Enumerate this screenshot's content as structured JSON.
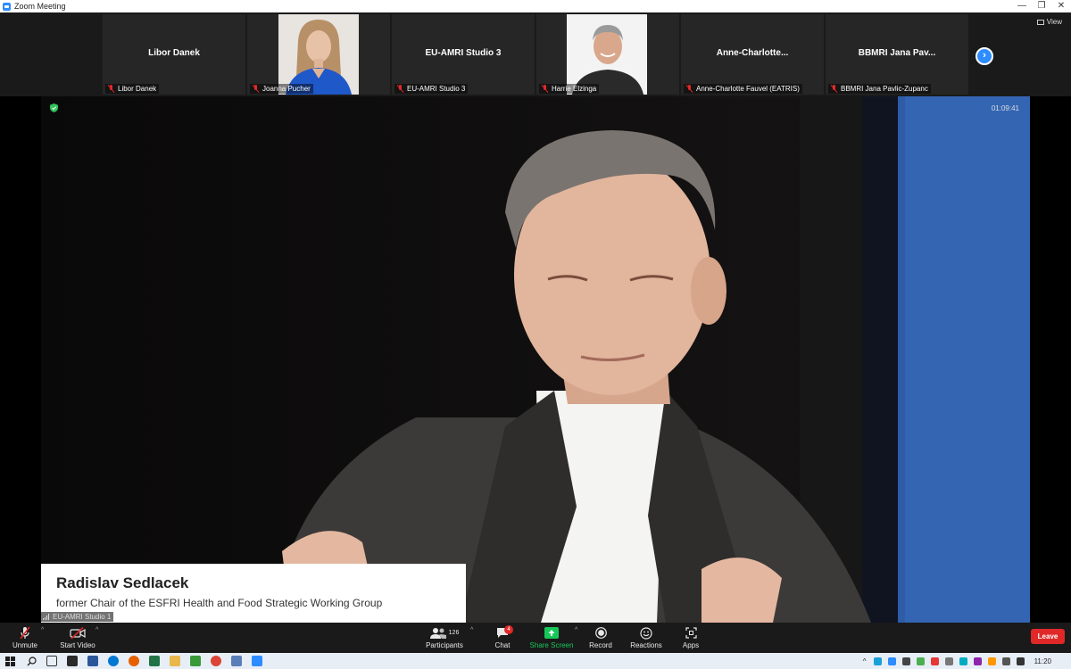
{
  "window": {
    "title": "Zoom Meeting",
    "controls": [
      "—",
      "❐",
      "✕"
    ]
  },
  "strip": {
    "view_label": "View",
    "tiles": [
      {
        "display_name": "Libor Danek",
        "label": "Libor Danek"
      },
      {
        "display_name": "",
        "label": "Joanna Pucher"
      },
      {
        "display_name": "EU-AMRI Studio 3",
        "label": "EU-AMRI Studio 3"
      },
      {
        "display_name": "",
        "label": "Harrie Elzinga"
      },
      {
        "display_name": "Anne-Charlotte...",
        "label": "Anne-Charlotte Fauvel (EATRIS)"
      },
      {
        "display_name": "BBMRI Jana Pav...",
        "label": "BBMRI Jana Pavlic-Zupanc"
      }
    ],
    "next_icon": "›"
  },
  "main": {
    "timer": "01:09:41",
    "speaker_name": "Radislav Sedlacek",
    "speaker_title": "former Chair of the ESFRI Health and Food Strategic Working Group",
    "participant_label": "EU-AMRI Studio 1"
  },
  "toolbar": {
    "unmute": "Unmute",
    "start_video": "Start Video",
    "participants": "Participants",
    "participant_count": "126",
    "chat": "Chat",
    "chat_badge": "4",
    "share_screen": "Share Screen",
    "record": "Record",
    "reactions": "Reactions",
    "apps": "Apps",
    "leave": "Leave",
    "caret": "^"
  },
  "taskbar": {
    "time": "11:20"
  },
  "colors": {
    "accent": "#2d8cff",
    "share": "#17c75a",
    "leave": "#e02828"
  }
}
